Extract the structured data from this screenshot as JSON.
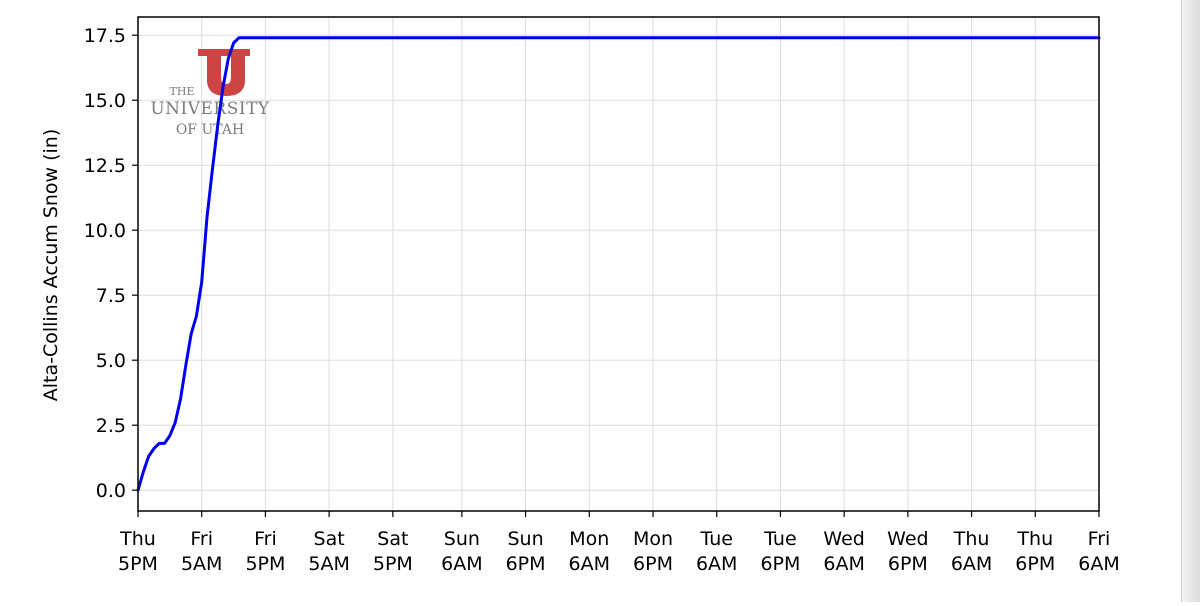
{
  "chart_data": {
    "type": "line",
    "title": "",
    "xlabel": "",
    "ylabel": "Alta-Collins Accum Snow (in)",
    "ylim": [
      -0.8,
      18.2
    ],
    "yticks": [
      0.0,
      2.5,
      5.0,
      7.5,
      10.0,
      12.5,
      15.0,
      17.5
    ],
    "ytick_labels": [
      "0.0",
      "2.5",
      "5.0",
      "7.5",
      "10.0",
      "12.5",
      "15.0",
      "17.5"
    ],
    "x_unit": "hours from Thu 5PM",
    "xlim": [
      0,
      181
    ],
    "xticks": [
      0,
      12,
      24,
      36,
      48,
      61,
      73,
      85,
      97,
      109,
      121,
      133,
      145,
      157,
      169,
      181
    ],
    "xtick_labels": [
      [
        "Thu",
        "5PM"
      ],
      [
        "Fri",
        "5AM"
      ],
      [
        "Fri",
        "5PM"
      ],
      [
        "Sat",
        "5AM"
      ],
      [
        "Sat",
        "5PM"
      ],
      [
        "Sun",
        "6AM"
      ],
      [
        "Sun",
        "6PM"
      ],
      [
        "Mon",
        "6AM"
      ],
      [
        "Mon",
        "6PM"
      ],
      [
        "Tue",
        "6AM"
      ],
      [
        "Tue",
        "6PM"
      ],
      [
        "Wed",
        "6AM"
      ],
      [
        "Wed",
        "6PM"
      ],
      [
        "Thu",
        "6AM"
      ],
      [
        "Thu",
        "6PM"
      ],
      [
        "Fri",
        "6AM"
      ]
    ],
    "grid": true,
    "series": [
      {
        "color": "#0000ee",
        "x": [
          0,
          1,
          2,
          3,
          4,
          5,
          6,
          7,
          8,
          9,
          10,
          11,
          12,
          13,
          14,
          15,
          16,
          17,
          18,
          19,
          20,
          21,
          22,
          23,
          24,
          25,
          26,
          181
        ],
        "y": [
          0.0,
          0.7,
          1.3,
          1.6,
          1.8,
          1.8,
          2.1,
          2.6,
          3.5,
          4.8,
          6.0,
          6.7,
          8.0,
          10.5,
          12.3,
          14.0,
          15.5,
          16.6,
          17.2,
          17.4,
          17.4,
          17.4,
          17.4,
          17.4,
          17.4,
          17.4,
          17.4,
          17.4
        ]
      }
    ]
  },
  "logo": {
    "line1": "THE",
    "line2": "UNIVERSITY",
    "line3": "OF UTAH",
    "letter": "U",
    "color": "#cc4444"
  }
}
